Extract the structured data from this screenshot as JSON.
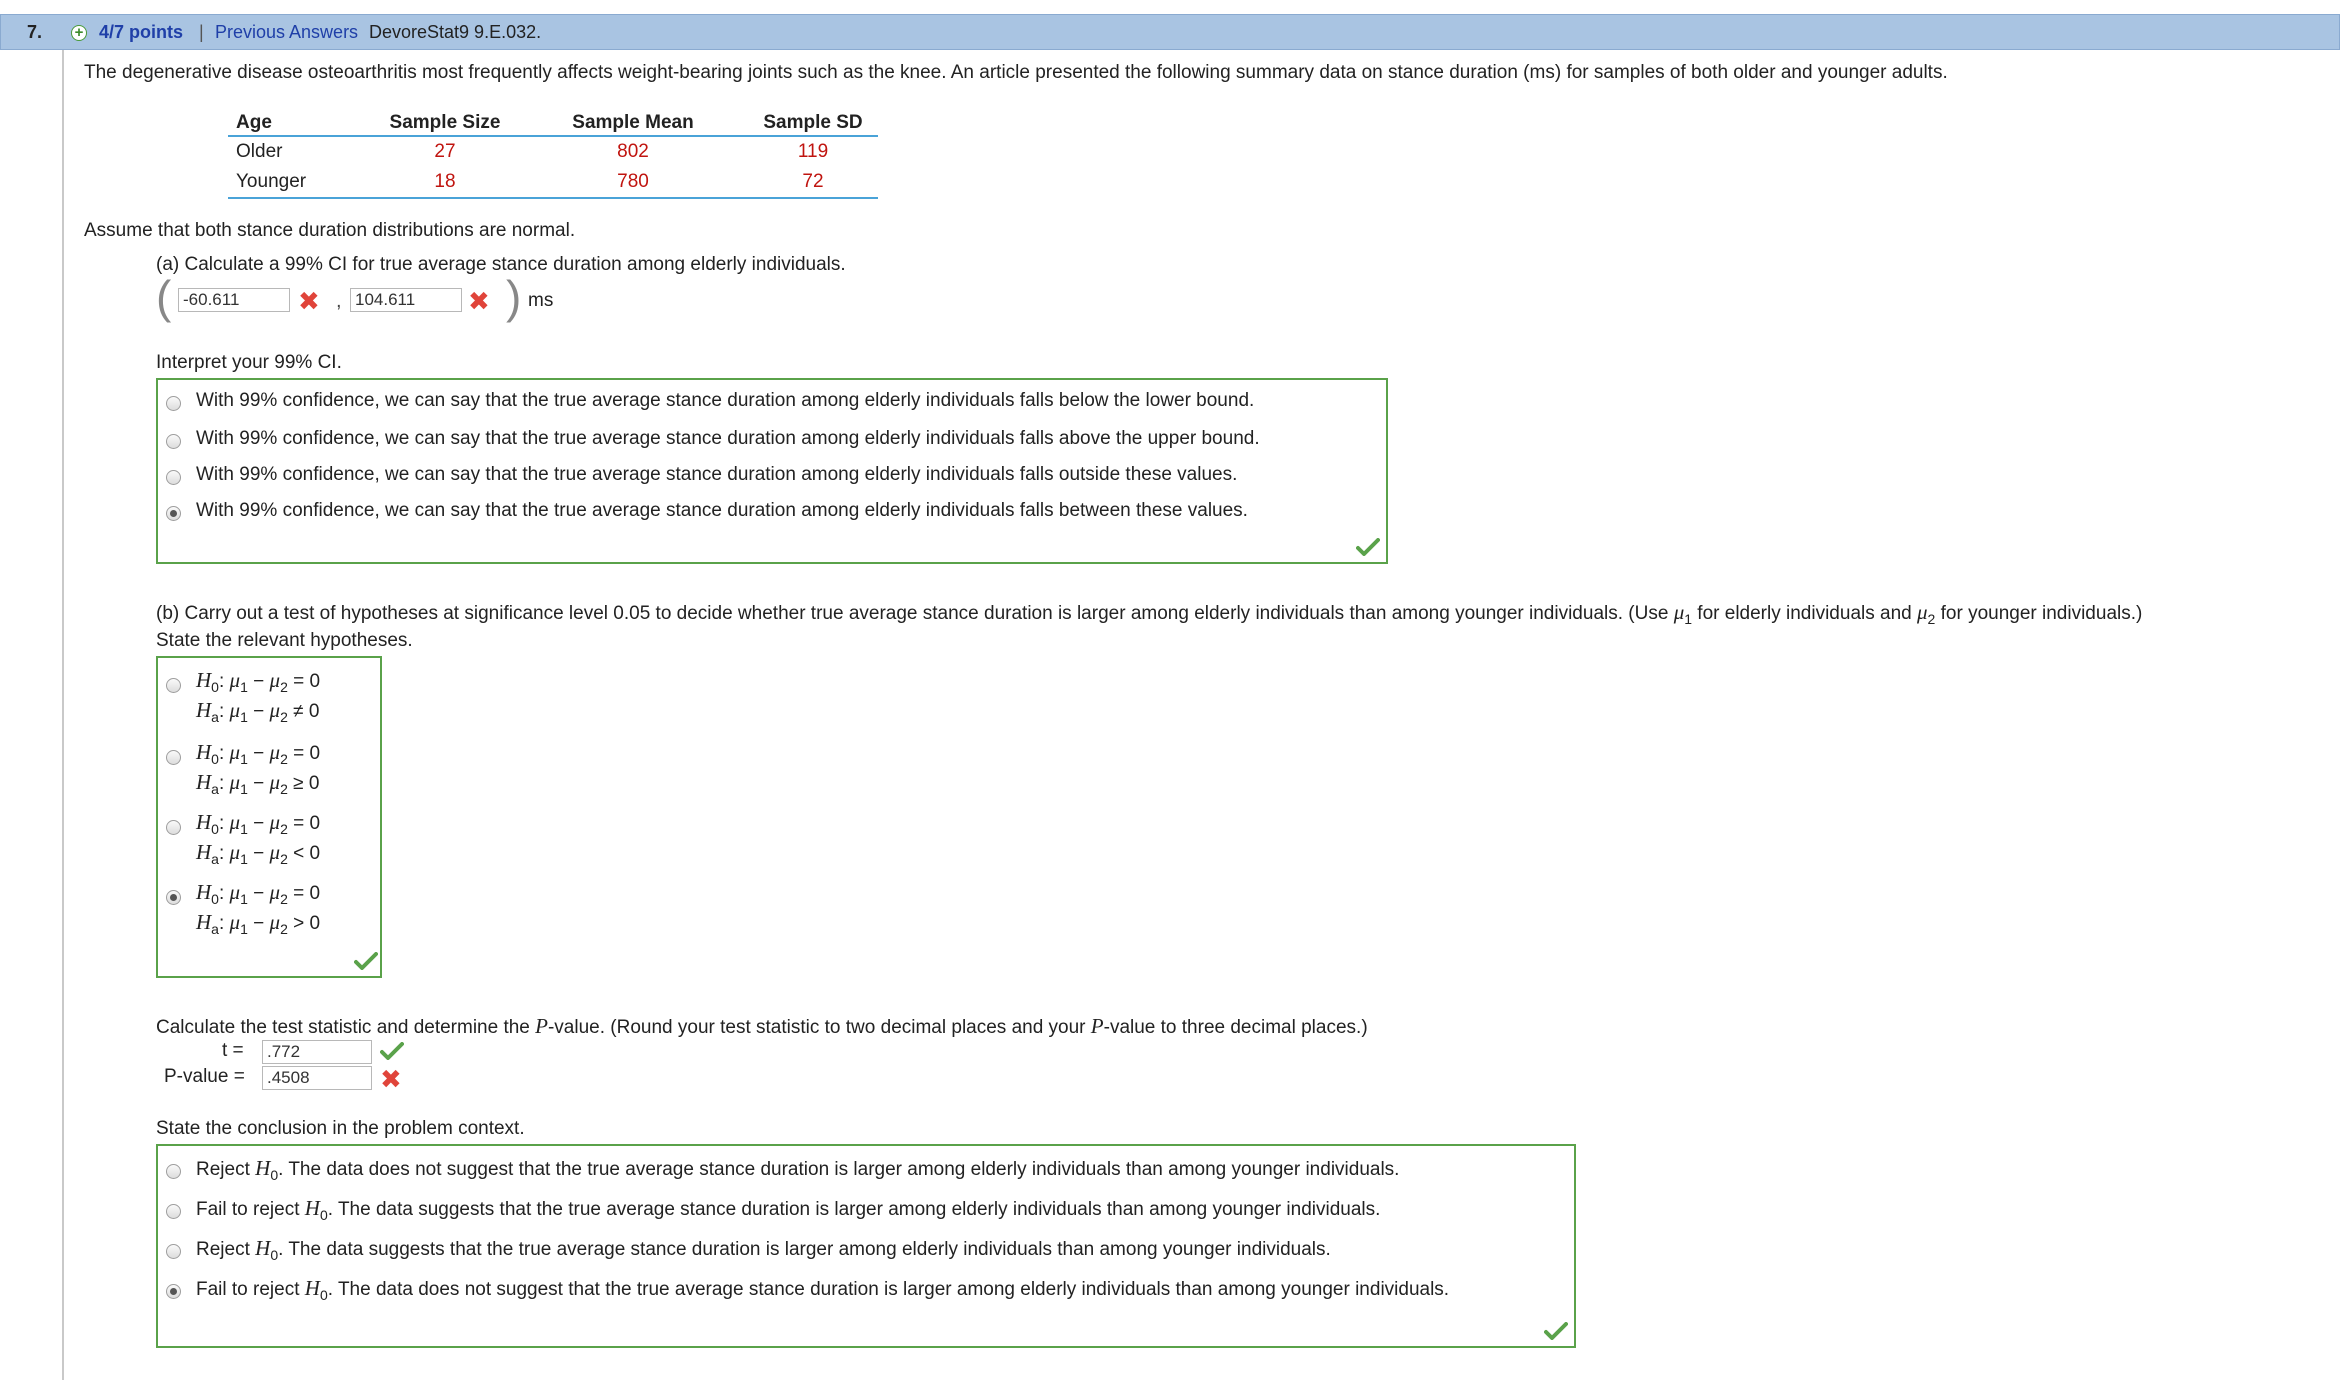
{
  "header": {
    "question_number": "7.",
    "points": "4/7 points",
    "separator": "|",
    "previous_answers": "Previous Answers",
    "problem_code": "DevoreStat9 9.E.032."
  },
  "intro": "The degenerative disease osteoarthritis most frequently affects weight-bearing joints such as the knee. An article presented the following summary data on stance duration (ms) for samples of both older and younger adults.",
  "table": {
    "headers": [
      "Age",
      "Sample Size",
      "Sample Mean",
      "Sample SD"
    ],
    "rows": [
      [
        "Older",
        "27",
        "802",
        "119"
      ],
      [
        "Younger",
        "18",
        "780",
        "72"
      ]
    ]
  },
  "assume": "Assume that both stance duration distributions are normal.",
  "part_a": {
    "prompt": "(a) Calculate a 99% CI for true average stance duration among elderly individuals.",
    "lower_value": "-60.611",
    "upper_value": "104.611",
    "comma": ",",
    "unit": "ms",
    "interpret_label": "Interpret your 99% CI.",
    "options": [
      "With 99% confidence, we can say that the true average stance duration among elderly individuals falls below the lower bound.",
      "With 99% confidence, we can say that the true average stance duration among elderly individuals falls above the upper bound.",
      "With 99% confidence, we can say that the true average stance duration among elderly individuals falls outside these values.",
      "With 99% confidence, we can say that the true average stance duration among elderly individuals falls between these values."
    ],
    "selected_index": 3
  },
  "part_b": {
    "prompt": "(b) Carry out a test of hypotheses at significance level 0.05 to decide whether true average stance duration is larger among elderly individuals than among younger individuals. (Use μ1 for elderly individuals and μ2 for younger individuals.)",
    "hyp_label": "State the relevant hypotheses.",
    "hypotheses": [
      {
        "h0": "0",
        "ha_op": "≠",
        "ha": "0"
      },
      {
        "h0": "0",
        "ha_op": "≥",
        "ha": "0"
      },
      {
        "h0": "0",
        "ha_op": "<",
        "ha": "0"
      },
      {
        "h0": "0",
        "ha_op": ">",
        "ha": "0"
      }
    ],
    "selected_index": 3,
    "calc_prompt": "Calculate the test statistic and determine the P-value. (Round your test statistic to two decimal places and your P-value to three decimal places.)",
    "t_label": "t =",
    "t_value": ".772",
    "p_label": "P-value =",
    "p_value": ".4508",
    "conclusion_label": "State the conclusion in the problem context.",
    "conclusions": [
      {
        "lead": "Reject",
        "rest": ". The data does not suggest that the true average stance duration is larger among elderly individuals than among younger individuals."
      },
      {
        "lead": "Fail to reject",
        "rest": ". The data suggests that the true average stance duration is larger among elderly individuals than among younger individuals."
      },
      {
        "lead": "Reject",
        "rest": ". The data suggests that the true average stance duration is larger among elderly individuals than among younger individuals."
      },
      {
        "lead": "Fail to reject",
        "rest": ". The data does not suggest that the true average stance duration is larger among elderly individuals than among younger individuals."
      }
    ],
    "conclusion_selected_index": 3
  },
  "colors": {
    "header_bg": "#a9c4e2",
    "link": "#1f3fa8",
    "correct_green": "#5aa24a",
    "wrong_red": "#e0443a",
    "value_red": "#c0140f",
    "table_rule": "#4aa3d8"
  },
  "icons": {
    "correct": "checkmark-icon",
    "incorrect": "x-mark-icon",
    "points": "plus-circle-icon"
  }
}
